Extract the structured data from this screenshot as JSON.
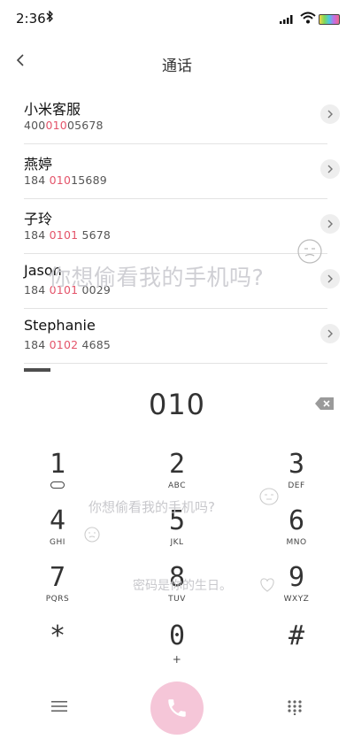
{
  "status_bar": {
    "time": "2:36",
    "bluetooth_icon": "bluetooth-icon",
    "signal_icon": "signal-icon",
    "wifi_icon": "wifi-icon",
    "battery_icon": "battery-icon"
  },
  "header": {
    "title": "通话",
    "back_icon": "back-arrow-icon"
  },
  "contacts": [
    {
      "name": "小米客服",
      "num_pre": "400",
      "num_hl": "010",
      "num_post": "05678"
    },
    {
      "name": "燕婷",
      "num_pre": "184 ",
      "num_hl": "010",
      "num_post": "15689"
    },
    {
      "name": "子玲",
      "num_pre": "184 ",
      "num_hl": "0101",
      "num_post": " 5678"
    },
    {
      "name": "Jason",
      "num_pre": "184 ",
      "num_hl": "0101",
      "num_post": " 0029"
    },
    {
      "name": "Stephanie",
      "num_pre": "184 ",
      "num_hl": "0102",
      "num_post": " 4685"
    }
  ],
  "watermark": {
    "line1": "你想偷看我的手机吗?",
    "line2": "你想偷看我的手机吗?",
    "line3": "密码是你的生日。"
  },
  "dial": {
    "number": "010",
    "backspace_icon": "backspace-icon"
  },
  "keypad": [
    {
      "digit": "1",
      "letters": ""
    },
    {
      "digit": "2",
      "letters": "ABC"
    },
    {
      "digit": "3",
      "letters": "DEF"
    },
    {
      "digit": "4",
      "letters": "GHI"
    },
    {
      "digit": "5",
      "letters": "JKL"
    },
    {
      "digit": "6",
      "letters": "MNO"
    },
    {
      "digit": "7",
      "letters": "PQRS"
    },
    {
      "digit": "8",
      "letters": "TUV"
    },
    {
      "digit": "9",
      "letters": "WXYZ"
    },
    {
      "digit": "*",
      "letters": ""
    },
    {
      "digit": "0",
      "letters": "+"
    },
    {
      "digit": "#",
      "letters": ""
    }
  ],
  "bottom_bar": {
    "menu_icon": "menu-icon",
    "call_icon": "phone-icon",
    "keypad_icon": "keypad-grid-icon"
  },
  "colors": {
    "highlight": "#e4546a",
    "call_button": "#f5c6d8"
  }
}
